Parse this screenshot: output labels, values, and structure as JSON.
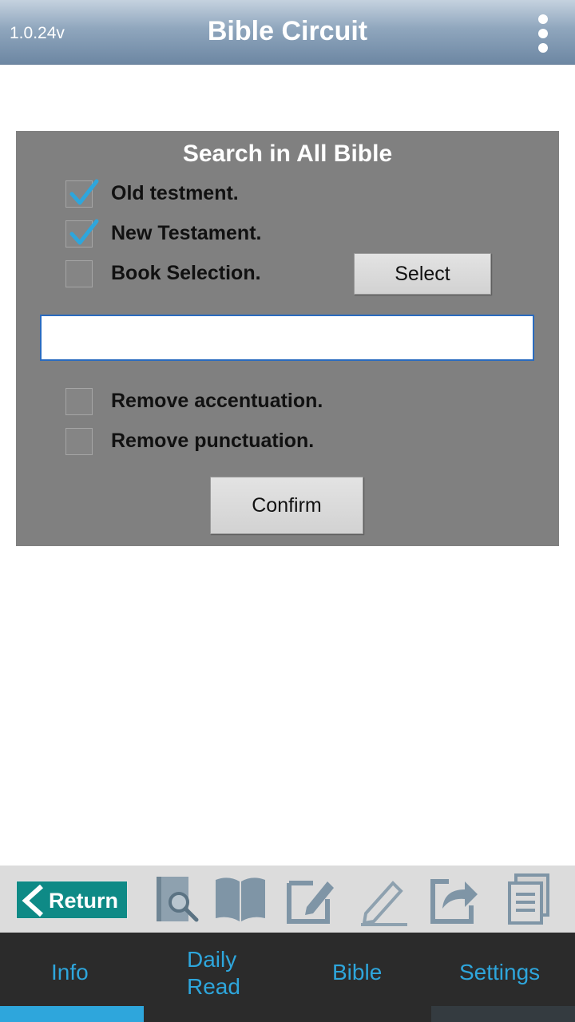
{
  "header": {
    "version": "1.0.24v",
    "title": "Bible Circuit",
    "menu_icon": "more-vert-icon"
  },
  "search_panel": {
    "title": "Search in All Bible",
    "options": [
      {
        "label": "Old testment.",
        "checked": true
      },
      {
        "label": "New Testament.",
        "checked": true
      },
      {
        "label": "Book Selection.",
        "checked": false
      }
    ],
    "select_button": "Select",
    "search_value": "",
    "text_options": [
      {
        "label": "Remove accentuation.",
        "checked": false
      },
      {
        "label": "Remove punctuation.",
        "checked": false
      }
    ],
    "confirm_button": "Confirm",
    "check_color": "#2ea6dc"
  },
  "toolbar": {
    "return_label": "Return",
    "icons": [
      "search-book-icon",
      "open-book-icon",
      "edit-note-icon",
      "pencil-icon",
      "share-icon",
      "copy-icon"
    ]
  },
  "bottom_nav": {
    "tabs": [
      {
        "label": "Info",
        "active": true
      },
      {
        "label": "Daily Read",
        "line1": "Daily",
        "line2": "Read"
      },
      {
        "label": "Bible"
      },
      {
        "label": "Settings"
      }
    ],
    "accent": "#2ea6dc"
  }
}
